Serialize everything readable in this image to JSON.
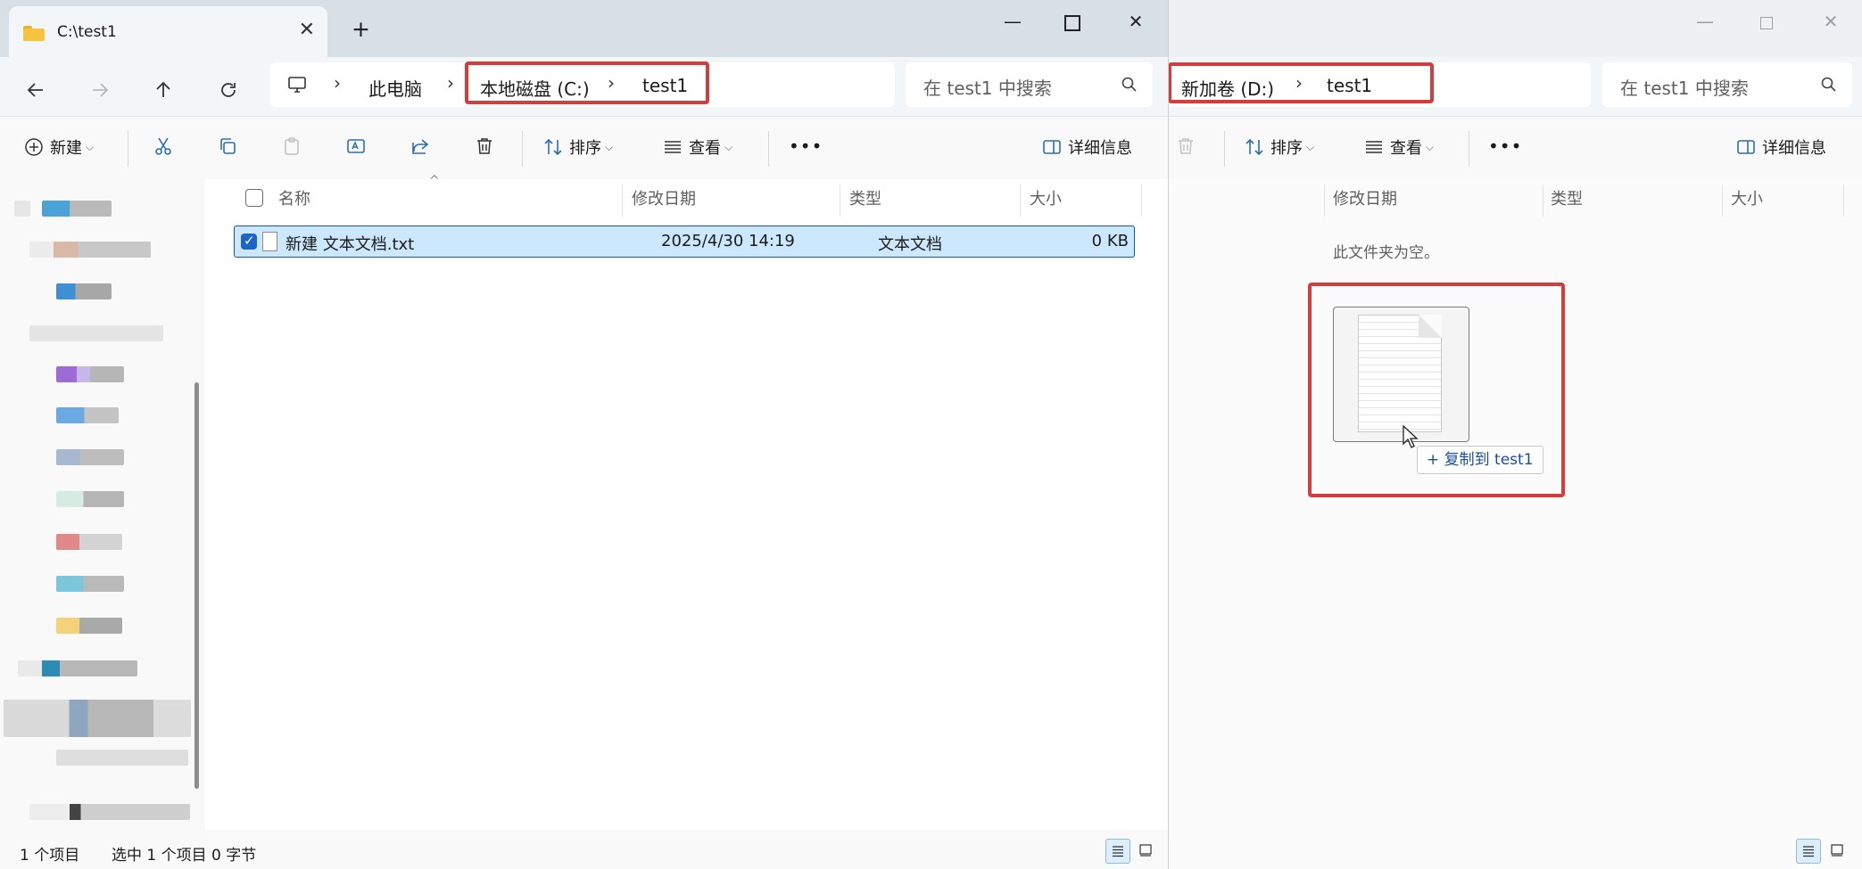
{
  "window_left": {
    "tab_title": "C:\\test1",
    "tab_close": "✕",
    "new_tab": "+",
    "caption": {
      "minimize": "—",
      "close": "✕"
    },
    "breadcrumb": [
      "此电脑",
      "本地磁盘 (C:)",
      "test1"
    ],
    "breadcrumb_sep": "›",
    "search_placeholder": "在 test1 中搜索",
    "toolbar": {
      "new": "新建",
      "sort": "排序",
      "view": "查看",
      "more": "•••",
      "details": "详细信息"
    },
    "columns": {
      "name": "名称",
      "modified": "修改日期",
      "type": "类型",
      "size": "大小"
    },
    "files": [
      {
        "name": "新建 文本文档.txt",
        "modified": "2025/4/30 14:19",
        "type": "文本文档",
        "size": "0 KB",
        "selected": true
      }
    ],
    "status": {
      "count": "1 个项目",
      "selection": "选中 1 个项目  0 字节"
    }
  },
  "window_right": {
    "caption": {
      "minimize": "—",
      "close": "✕"
    },
    "breadcrumb": [
      "新加卷 (D:)",
      "test1"
    ],
    "breadcrumb_sep": "›",
    "search_placeholder": "在 test1 中搜索",
    "toolbar": {
      "sort": "排序",
      "view": "查看",
      "more": "•••",
      "details": "详细信息"
    },
    "columns": {
      "modified": "修改日期",
      "type": "类型",
      "size": "大小"
    },
    "empty_message": "此文件夹为空。",
    "drag_tooltip": "+ 复制到 test1"
  },
  "colors": {
    "highlight": "#d53d3d",
    "selection_fill": "#cce8ff",
    "selection_border": "#0f5aa6",
    "accent": "#1e63c6"
  },
  "icons": [
    "folder-icon",
    "back-arrow-icon",
    "forward-arrow-icon",
    "up-arrow-icon",
    "refresh-icon",
    "computer-icon",
    "search-icon",
    "plus-circle-icon",
    "cut-icon",
    "copy-icon",
    "paste-icon",
    "rename-icon",
    "share-icon",
    "delete-icon",
    "sort-icon",
    "view-icon",
    "details-pane-icon",
    "text-file-icon",
    "drag-cursor-icon"
  ]
}
